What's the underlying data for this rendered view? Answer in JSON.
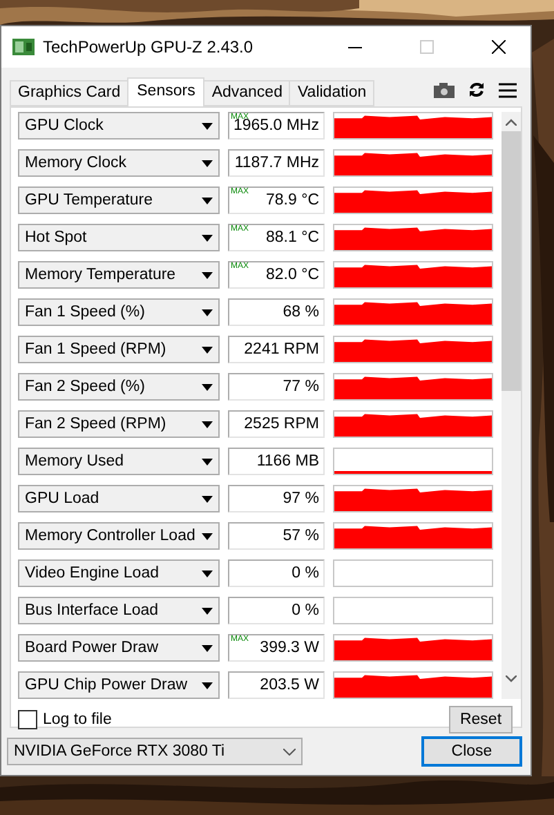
{
  "window": {
    "title": "TechPowerUp GPU-Z 2.43.0"
  },
  "tabs": [
    {
      "label": "Graphics Card",
      "selected": false
    },
    {
      "label": "Sensors",
      "selected": true
    },
    {
      "label": "Advanced",
      "selected": false
    },
    {
      "label": "Validation",
      "selected": false
    }
  ],
  "sensors": [
    {
      "name": "GPU Clock",
      "max_label": "MAX",
      "value": "1965.0 MHz",
      "kind": "high"
    },
    {
      "name": "Memory Clock",
      "value": "1187.7 MHz",
      "kind": "high"
    },
    {
      "name": "GPU Temperature",
      "max_label": "MAX",
      "value": "78.9 °C",
      "kind": "high"
    },
    {
      "name": "Hot Spot",
      "max_label": "MAX",
      "value": "88.1 °C",
      "kind": "high"
    },
    {
      "name": "Memory Temperature",
      "max_label": "MAX",
      "value": "82.0 °C",
      "kind": "high"
    },
    {
      "name": "Fan 1 Speed (%)",
      "value": "68 %",
      "kind": "high"
    },
    {
      "name": "Fan 1 Speed (RPM)",
      "value": "2241 RPM",
      "kind": "high"
    },
    {
      "name": "Fan 2 Speed (%)",
      "value": "77 %",
      "kind": "high"
    },
    {
      "name": "Fan 2 Speed (RPM)",
      "value": "2525 RPM",
      "kind": "high"
    },
    {
      "name": "Memory Used",
      "value": "1166 MB",
      "kind": "low"
    },
    {
      "name": "GPU Load",
      "value": "97 %",
      "kind": "high"
    },
    {
      "name": "Memory Controller Load",
      "value": "57 %",
      "kind": "high"
    },
    {
      "name": "Video Engine Load",
      "value": "0 %",
      "kind": "idle"
    },
    {
      "name": "Bus Interface Load",
      "value": "0 %",
      "kind": "idle"
    },
    {
      "name": "Board Power Draw",
      "max_label": "MAX",
      "value": "399.3 W",
      "kind": "high"
    },
    {
      "name": "GPU Chip Power Draw",
      "value": "203.5 W",
      "kind": "high"
    }
  ],
  "log_to_file": {
    "label": "Log to file",
    "checked": false
  },
  "reset_button": "Reset",
  "device_select": {
    "value": "NVIDIA GeForce RTX 3080 Ti"
  },
  "close_button": "Close"
}
